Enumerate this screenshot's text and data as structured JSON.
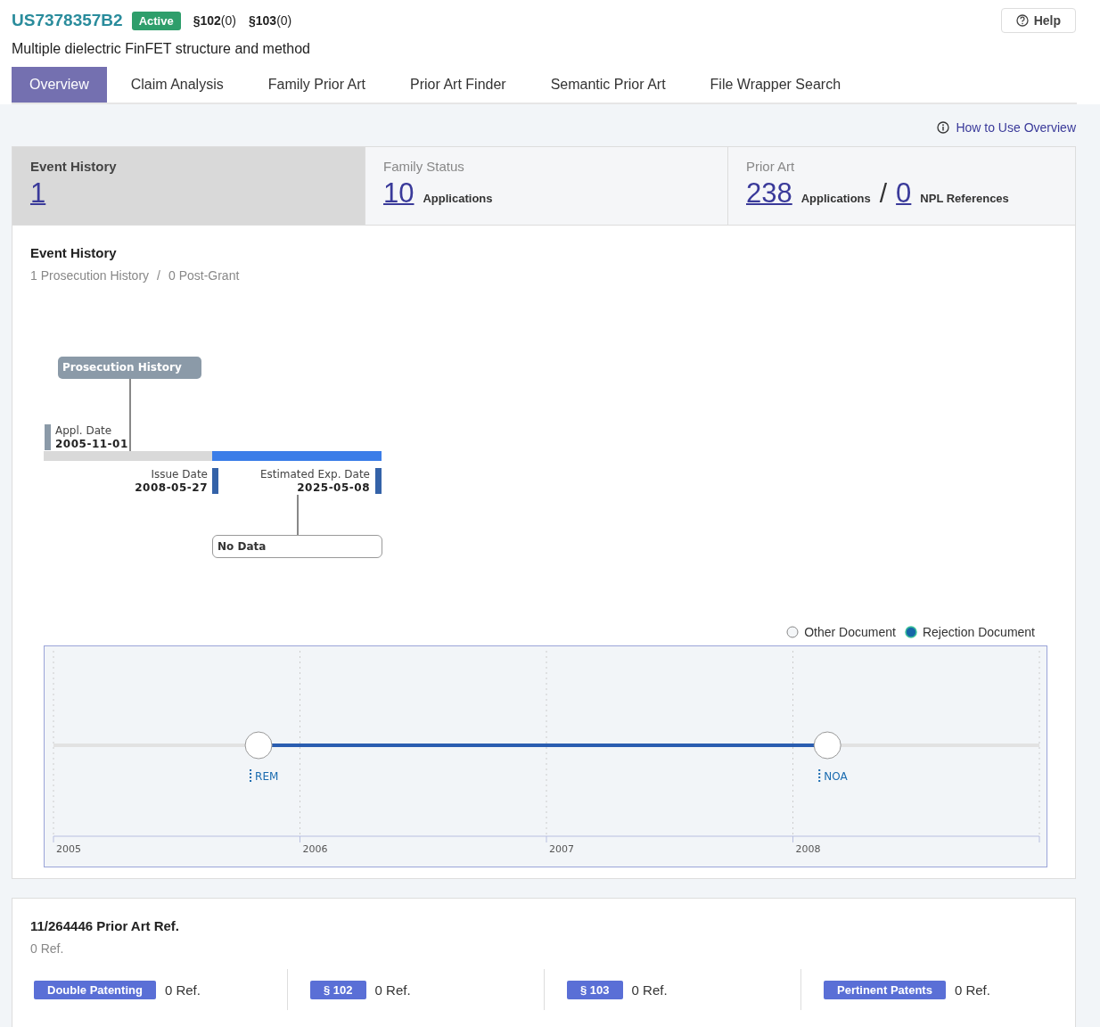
{
  "header": {
    "patent_number": "US7378357B2",
    "status": "Active",
    "citations": [
      {
        "section": "§102",
        "count": "(0)"
      },
      {
        "section": "§103",
        "count": "(0)"
      }
    ],
    "help": "Help",
    "title": "Multiple dielectric FinFET structure and method"
  },
  "tabs": [
    {
      "label": "Overview",
      "selected": true
    },
    {
      "label": "Claim Analysis",
      "selected": false
    },
    {
      "label": "Family Prior Art",
      "selected": false
    },
    {
      "label": "Prior Art Finder",
      "selected": false
    },
    {
      "label": "Semantic Prior Art",
      "selected": false
    },
    {
      "label": "File Wrapper Search",
      "selected": false
    }
  ],
  "how_to_link": "How to Use Overview",
  "stats": [
    {
      "label": "Event History",
      "selected": true,
      "values": [
        {
          "value": "1"
        }
      ]
    },
    {
      "label": "Family Status",
      "selected": false,
      "values": [
        {
          "value": "10",
          "unit": "Applications"
        }
      ]
    },
    {
      "label": "Prior Art",
      "selected": false,
      "separator": "/",
      "values": [
        {
          "value": "238",
          "unit": "Applications"
        },
        {
          "value": "0",
          "unit": "NPL References"
        }
      ]
    }
  ],
  "event_history": {
    "title": "Event History",
    "summary": [
      "1 Prosecution History",
      "0 Post-Grant"
    ],
    "summary_separator": "/",
    "timeline": {
      "group_label": "Prosecution History",
      "appl": {
        "label": "Appl. Date",
        "date": "2005-11-01"
      },
      "issue": {
        "label": "Issue Date",
        "date": "2008-05-27"
      },
      "expiry": {
        "label": "Estimated Exp. Date",
        "date": "2025-05-08"
      },
      "status_note": "No Data"
    },
    "legend": [
      {
        "label": "Other Document",
        "kind": "other"
      },
      {
        "label": "Rejection Document",
        "kind": "rejection"
      }
    ],
    "document_timeline": {
      "year_labels": [
        "2005",
        "2006",
        "2007",
        "2008"
      ],
      "events": [
        {
          "label": "REM",
          "kind": "other"
        },
        {
          "label": "NOA",
          "kind": "other"
        }
      ]
    }
  },
  "prior_art_ref": {
    "title": "11/264446 Prior Art Ref.",
    "count": "0 Ref.",
    "categories": [
      {
        "tag": "Double Patenting",
        "count": "0 Ref."
      },
      {
        "tag": "§ 102",
        "count": "0 Ref."
      },
      {
        "tag": "§ 103",
        "count": "0 Ref."
      },
      {
        "tag": "Pertinent Patents",
        "count": "0 Ref."
      }
    ]
  }
}
